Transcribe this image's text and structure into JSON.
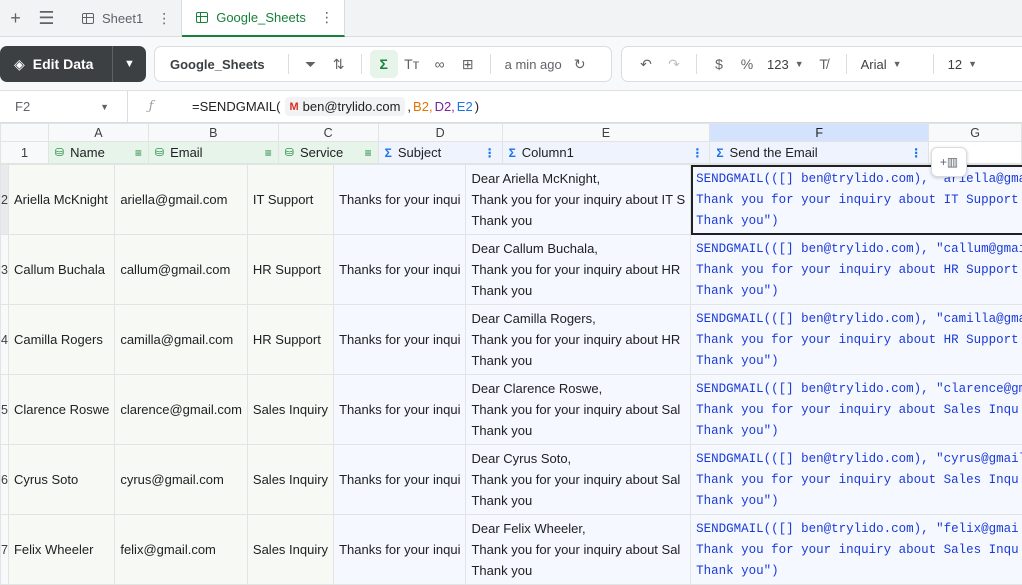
{
  "tabs": [
    {
      "label": "Sheet1",
      "active": false
    },
    {
      "label": "Google_Sheets",
      "active": true
    }
  ],
  "toolbar": {
    "edit_label": "Edit Data",
    "table_name": "Google_Sheets",
    "last_saved": "a min ago",
    "currency": "$",
    "percent": "%",
    "number_format": "123",
    "font": "Arial",
    "font_size": "12"
  },
  "formula_bar": {
    "cell_ref": "F2",
    "fx": "ƒ",
    "prefix": "=SENDGMAIL(",
    "chip_email": "ben@trylido.com",
    "sep": " ,",
    "ref1": "B2,",
    "ref2": "D2,",
    "ref3": "E2",
    "suffix": ")"
  },
  "columns": [
    "A",
    "B",
    "C",
    "D",
    "E",
    "F",
    "G"
  ],
  "headers": [
    {
      "label": "Name",
      "kind": "source"
    },
    {
      "label": "Email",
      "kind": "source"
    },
    {
      "label": "Service",
      "kind": "source"
    },
    {
      "label": "Subject",
      "kind": "calc"
    },
    {
      "label": "Column1",
      "kind": "calc"
    },
    {
      "label": "Send the Email",
      "kind": "calc"
    }
  ],
  "rows": [
    {
      "num": "2",
      "name": "Ariella McKnight",
      "email": "ariella@gmail.com",
      "service": "IT Support",
      "subject": "Thanks for your inqui",
      "col1": [
        "Dear Ariella McKnight,",
        "Thank you for your inquiry about IT S",
        "Thank you"
      ],
      "send": [
        "SENDGMAIL(([] ben@trylido.com), \"ariella@gma",
        "Thank you for your inquiry about IT Support",
        "Thank you\")"
      ]
    },
    {
      "num": "3",
      "name": "Callum Buchala",
      "email": "callum@gmail.com",
      "service": "HR Support",
      "subject": "Thanks for your inqui",
      "col1": [
        "Dear Callum Buchala,",
        "Thank you for your inquiry about HR",
        "Thank you"
      ],
      "send": [
        "SENDGMAIL(([] ben@trylido.com), \"callum@gmai",
        "Thank you for your inquiry about HR Support",
        "Thank you\")"
      ]
    },
    {
      "num": "4",
      "name": "Camilla Rogers",
      "email": "camilla@gmail.com",
      "service": "HR Support",
      "subject": "Thanks for your inqui",
      "col1": [
        "Dear Camilla Rogers,",
        "Thank you for your inquiry about HR",
        "Thank you"
      ],
      "send": [
        "SENDGMAIL(([] ben@trylido.com), \"camilla@gma",
        "Thank you for your inquiry about HR Support",
        "Thank you\")"
      ]
    },
    {
      "num": "5",
      "name": "Clarence Roswe",
      "email": "clarence@gmail.com",
      "service": "Sales Inquiry",
      "subject": "Thanks for your inqui",
      "col1": [
        "Dear Clarence Roswe,",
        "Thank you for your inquiry about Sal",
        "Thank you"
      ],
      "send": [
        "SENDGMAIL(([] ben@trylido.com), \"clarence@gm",
        "Thank you for your inquiry about Sales Inqu",
        "Thank you\")"
      ]
    },
    {
      "num": "6",
      "name": "Cyrus Soto",
      "email": "cyrus@gmail.com",
      "service": "Sales Inquiry",
      "subject": "Thanks for your inqui",
      "col1": [
        "Dear Cyrus Soto,",
        "Thank you for your inquiry about Sal",
        "Thank you"
      ],
      "send": [
        "SENDGMAIL(([] ben@trylido.com), \"cyrus@gmail",
        "Thank you for your inquiry about Sales Inqu",
        "Thank you\")"
      ]
    },
    {
      "num": "7",
      "name": "Felix Wheeler",
      "email": "felix@gmail.com",
      "service": "Sales Inquiry",
      "subject": "Thanks for your inqui",
      "col1": [
        "Dear Felix Wheeler,",
        "Thank you for your inquiry about Sal",
        "Thank you"
      ],
      "send": [
        "SENDGMAIL(([] ben@trylido.com), \"felix@gmai",
        "Thank you for your inquiry about Sales Inqu",
        "Thank you\")"
      ]
    }
  ],
  "colors": {
    "accent_green": "#188038",
    "calc_blue": "#1a73e8",
    "formula_text": "#1a3ad8",
    "edit_button": "#3c4043"
  }
}
